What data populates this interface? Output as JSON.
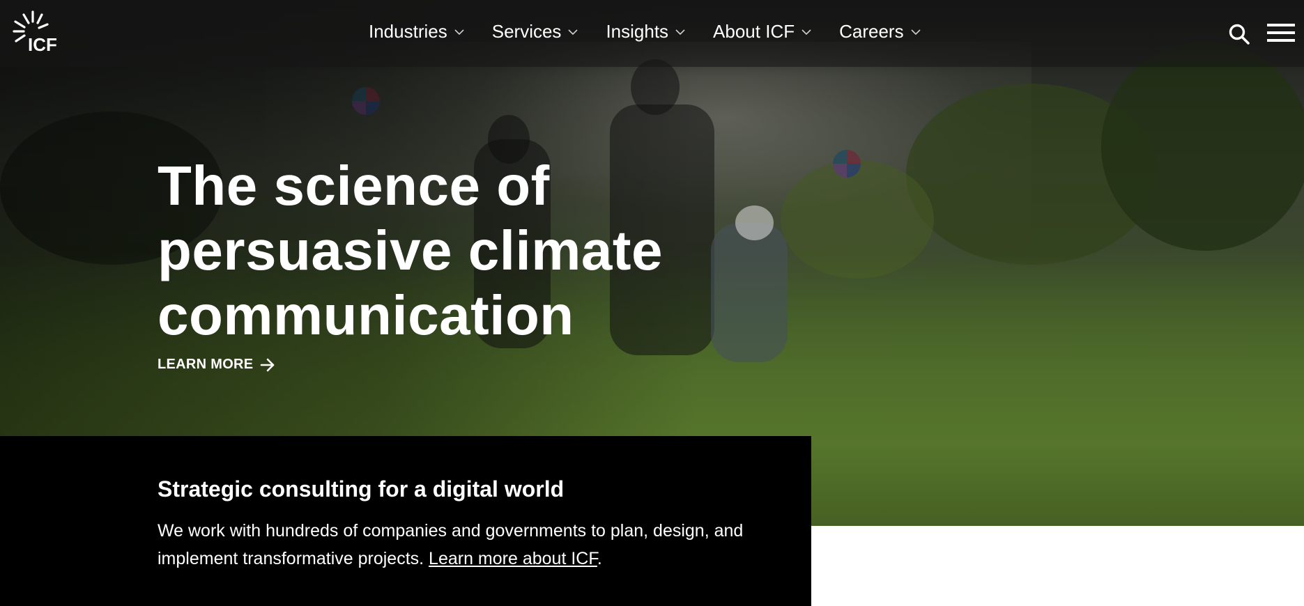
{
  "brand": {
    "logo_text": "ICF"
  },
  "nav": {
    "items": [
      {
        "label": "Industries"
      },
      {
        "label": "Services"
      },
      {
        "label": "Insights"
      },
      {
        "label": "About ICF"
      },
      {
        "label": "Careers"
      }
    ],
    "icons": [
      "chevron-down-icon",
      "search-icon",
      "hamburger-menu-icon"
    ]
  },
  "hero": {
    "headline": "The science of persuasive climate communication",
    "cta_label": "LEARN MORE"
  },
  "intro": {
    "heading": "Strategic consulting for a digital world",
    "body": "We work with hundreds of companies and governments to plan, design, and implement transformative projects.",
    "link_label": "Learn more about ICF",
    "suffix": "."
  },
  "colors": {
    "panel": "#000000",
    "text": "#ffffff"
  }
}
